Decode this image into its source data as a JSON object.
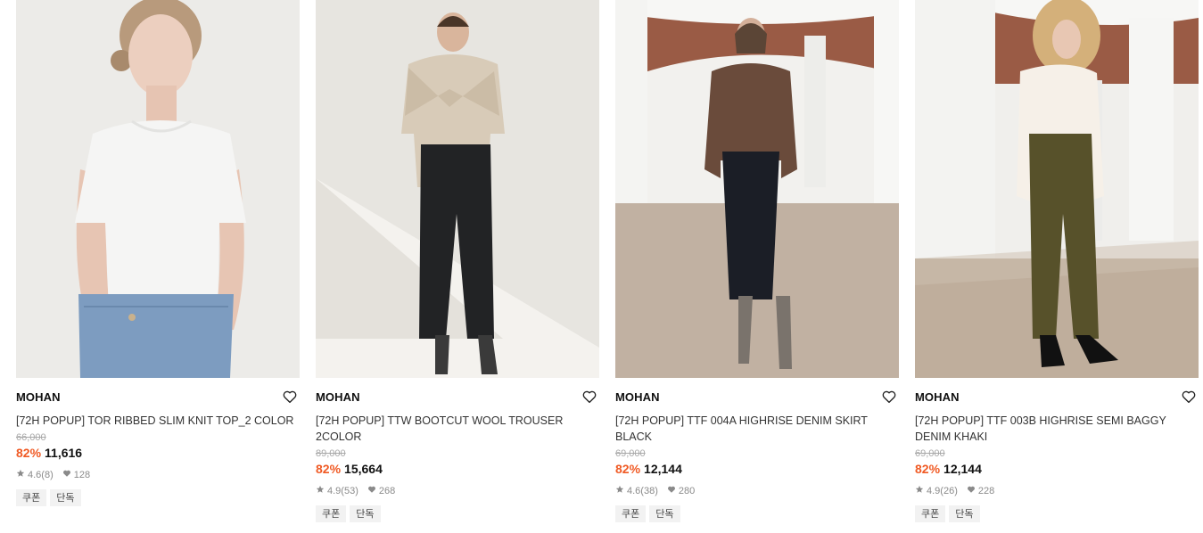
{
  "products": [
    {
      "brand": "MOHAN",
      "name": "[72H POPUP] TOR RIBBED SLIM KNIT TOP_2 COLOR",
      "original_price": "66,000",
      "discount": "82%",
      "price": "11,616",
      "rating": "4.6",
      "review_count": "(8)",
      "likes": "128",
      "tags": [
        "쿠폰",
        "단독"
      ]
    },
    {
      "brand": "MOHAN",
      "name": "[72H POPUP] TTW BOOTCUT WOOL TROUSER 2COLOR",
      "original_price": "89,000",
      "discount": "82%",
      "price": "15,664",
      "rating": "4.9",
      "review_count": "(53)",
      "likes": "268",
      "tags": [
        "쿠폰",
        "단독"
      ]
    },
    {
      "brand": "MOHAN",
      "name": "[72H POPUP] TTF 004A HIGHRISE DENIM SKIRT BLACK",
      "original_price": "69,000",
      "discount": "82%",
      "price": "12,144",
      "rating": "4.6",
      "review_count": "(38)",
      "likes": "280",
      "tags": [
        "쿠폰",
        "단독"
      ]
    },
    {
      "brand": "MOHAN",
      "name": "[72H POPUP] TTF 003B HIGHRISE SEMI BAGGY DENIM KHAKI",
      "original_price": "69,000",
      "discount": "82%",
      "price": "12,144",
      "rating": "4.9",
      "review_count": "(26)",
      "likes": "228",
      "tags": [
        "쿠폰",
        "단독"
      ]
    }
  ],
  "colors": {
    "discount": "#f05a24",
    "meta": "#8a8a8a",
    "tag_bg": "#f2f2f2"
  },
  "icons": {
    "wishlist": "heart-outline-icon",
    "rating": "star-icon",
    "likes": "heart-filled-icon"
  }
}
